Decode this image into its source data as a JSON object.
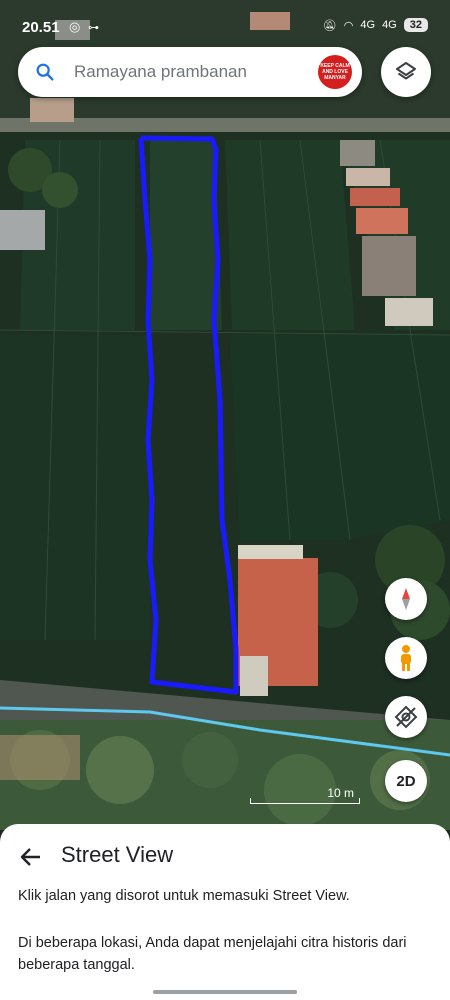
{
  "status_bar": {
    "time": "20.51",
    "network": "4G",
    "network2": "4G",
    "battery": "32"
  },
  "search": {
    "query": "Ramayana prambanan",
    "avatar_text": "KEEP CALM AND LOVE MANYAR"
  },
  "map": {
    "scale_label": "10 m",
    "mode_button": "2D",
    "outline_color": "#1a1aff",
    "road_color": "#5ec8ee"
  },
  "sheet": {
    "title": "Street View",
    "line1": "Klik jalan yang disorot untuk memasuki Street View.",
    "line2": "Di beberapa lokasi, Anda dapat menjelajahi citra historis dari beberapa tanggal."
  }
}
